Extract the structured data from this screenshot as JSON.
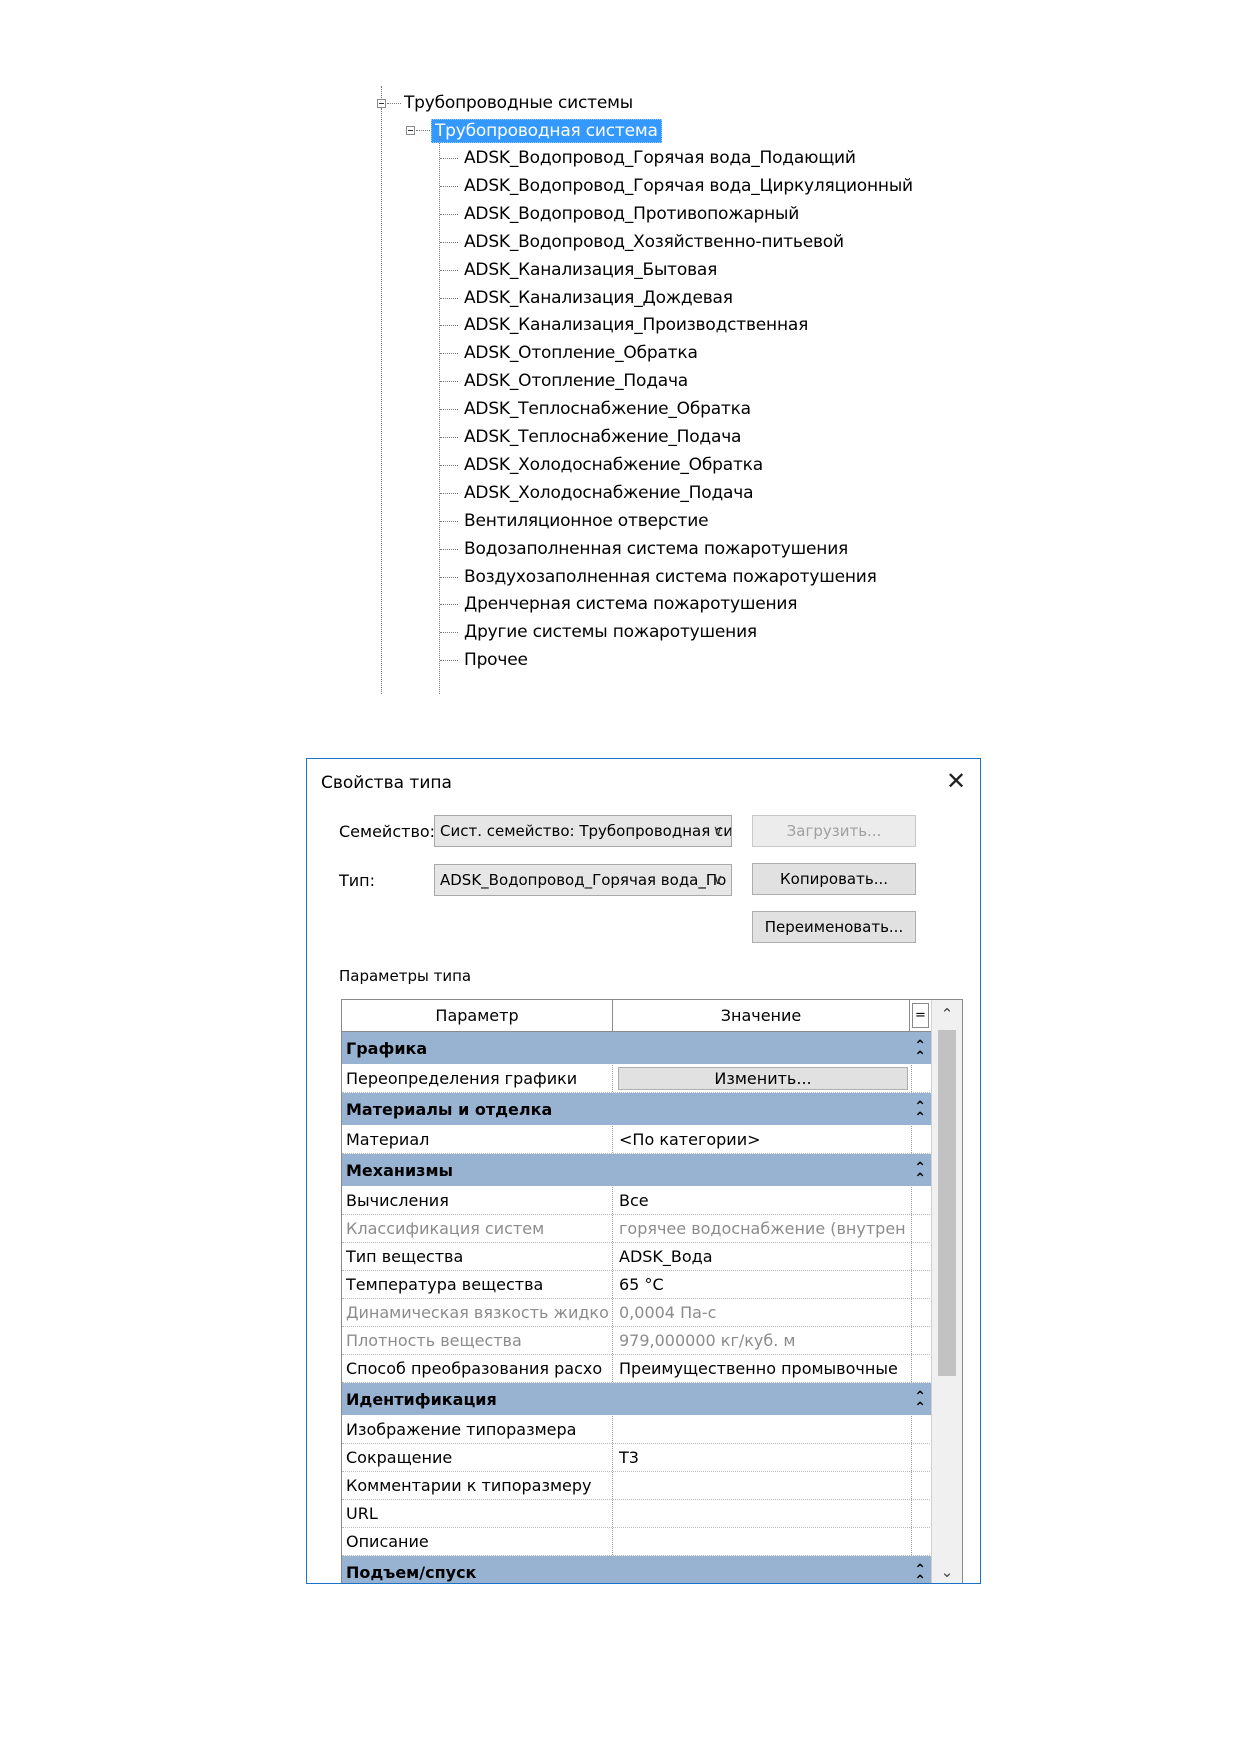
{
  "tree": {
    "root_label": "Трубопроводные системы",
    "child_label": "Трубопроводная система",
    "items": [
      "ADSK_Водопровод_Горячая вода_Подающий",
      "ADSK_Водопровод_Горячая вода_Циркуляционный",
      "ADSK_Водопровод_Противопожарный",
      "ADSK_Водопровод_Хозяйственно-питьевой",
      "ADSK_Канализация_Бытовая",
      "ADSK_Канализация_Дождевая",
      "ADSK_Канализация_Производственная",
      "ADSK_Отопление_Обратка",
      "ADSK_Отопление_Подача",
      "ADSK_Теплоснабжение_Обратка",
      "ADSK_Теплоснабжение_Подача",
      "ADSK_Холодоснабжение_Обратка",
      "ADSK_Холодоснабжение_Подача",
      "Вентиляционное отверстие",
      "Водозаполненная система пожаротушения",
      "Воздухозаполненная система пожаротушения",
      "Дренчерная система пожаротушения",
      "Другие системы пожаротушения",
      "Прочее"
    ]
  },
  "dialog": {
    "title": "Свойства типа",
    "family_label": "Семейство:",
    "family_value": "Сист. семейство: Трубопроводная си",
    "type_label": "Тип:",
    "type_value": "ADSK_Водопровод_Горячая вода_По",
    "load_button": "Загрузить...",
    "copy_button": "Копировать...",
    "rename_button": "Переименовать...",
    "params_caption": "Параметры типа",
    "col_param": "Параметр",
    "col_value": "Значение",
    "eq_symbol": "=",
    "groups": [
      {
        "name": "Графика",
        "rows": [
          {
            "param": "Переопределения графики",
            "value": "Изменить...",
            "button": true
          }
        ]
      },
      {
        "name": "Материалы и отделка",
        "rows": [
          {
            "param": "Материал",
            "value": "<По категории>"
          }
        ]
      },
      {
        "name": "Механизмы",
        "rows": [
          {
            "param": "Вычисления",
            "value": "Все"
          },
          {
            "param": "Классификация систем",
            "value": "горячее водоснабжение (внутрен",
            "dim": true
          },
          {
            "param": "Тип вещества",
            "value": "ADSK_Вода"
          },
          {
            "param": "Температура вещества",
            "value": "65 °C"
          },
          {
            "param": "Динамическая вязкость жидко",
            "value": "0,0004 Па-с",
            "dim": true
          },
          {
            "param": "Плотность вещества",
            "value": "979,000000 кг/куб. м",
            "dim": true
          },
          {
            "param": "Способ преобразования расхо",
            "value": "Преимущественно промывочные"
          }
        ]
      },
      {
        "name": "Идентификация",
        "rows": [
          {
            "param": "Изображение типоразмера",
            "value": ""
          },
          {
            "param": "Сокращение",
            "value": "Т3"
          },
          {
            "param": "Комментарии к типоразмеру",
            "value": ""
          },
          {
            "param": "URL",
            "value": ""
          },
          {
            "param": "Описание",
            "value": ""
          }
        ]
      },
      {
        "name": "Подъем/спуск",
        "rows": []
      }
    ]
  }
}
